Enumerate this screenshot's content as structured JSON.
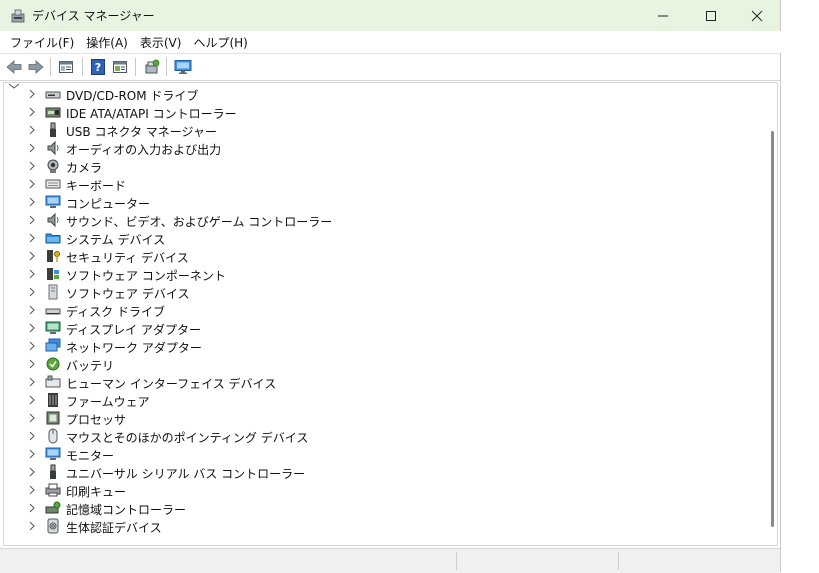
{
  "window": {
    "title": "デバイス マネージャー"
  },
  "menu": [
    {
      "label": "ファイル(F)",
      "name": "menu-file"
    },
    {
      "label": "操作(A)",
      "name": "menu-action"
    },
    {
      "label": "表示(V)",
      "name": "menu-view"
    },
    {
      "label": "ヘルプ(H)",
      "name": "menu-help"
    }
  ],
  "toolbar": [
    "back-icon",
    "forward-icon",
    "properties-icon",
    "help-icon",
    "console-tree-icon",
    "scan-hardware-icon",
    "monitor-icon"
  ],
  "tree": {
    "items": [
      {
        "label": "DVD/CD-ROM ドライブ",
        "icon": "dvd-drive-icon"
      },
      {
        "label": "IDE ATA/ATAPI コントローラー",
        "icon": "ide-controller-icon"
      },
      {
        "label": "USB コネクタ マネージャー",
        "icon": "usb-icon"
      },
      {
        "label": "オーディオの入力および出力",
        "icon": "speaker-icon"
      },
      {
        "label": "カメラ",
        "icon": "camera-icon"
      },
      {
        "label": "キーボード",
        "icon": "keyboard-icon"
      },
      {
        "label": "コンピューター",
        "icon": "computer-icon"
      },
      {
        "label": "サウンド、ビデオ、およびゲーム コントローラー",
        "icon": "speaker-icon"
      },
      {
        "label": "システム デバイス",
        "icon": "folder-icon"
      },
      {
        "label": "セキュリティ デバイス",
        "icon": "security-key-icon"
      },
      {
        "label": "ソフトウェア コンポーネント",
        "icon": "software-component-icon"
      },
      {
        "label": "ソフトウェア デバイス",
        "icon": "software-device-icon"
      },
      {
        "label": "ディスク ドライブ",
        "icon": "disk-drive-icon"
      },
      {
        "label": "ディスプレイ アダプター",
        "icon": "display-adapter-icon"
      },
      {
        "label": "ネットワーク アダプター",
        "icon": "network-adapter-icon"
      },
      {
        "label": "バッテリ",
        "icon": "battery-icon"
      },
      {
        "label": "ヒューマン インターフェイス デバイス",
        "icon": "hid-icon"
      },
      {
        "label": "ファームウェア",
        "icon": "firmware-icon"
      },
      {
        "label": "プロセッサ",
        "icon": "processor-icon"
      },
      {
        "label": "マウスとそのほかのポインティング デバイス",
        "icon": "mouse-icon"
      },
      {
        "label": "モニター",
        "icon": "monitor-icon"
      },
      {
        "label": "ユニバーサル シリアル バス コントローラー",
        "icon": "usb-icon"
      },
      {
        "label": "印刷キュー",
        "icon": "printer-icon"
      },
      {
        "label": "記憶域コントローラー",
        "icon": "storage-controller-icon"
      },
      {
        "label": "生体認証デバイス",
        "icon": "fingerprint-icon"
      }
    ]
  },
  "colors": {
    "titlebar": "#e9f3e2",
    "accent": "#2d7fd6"
  }
}
